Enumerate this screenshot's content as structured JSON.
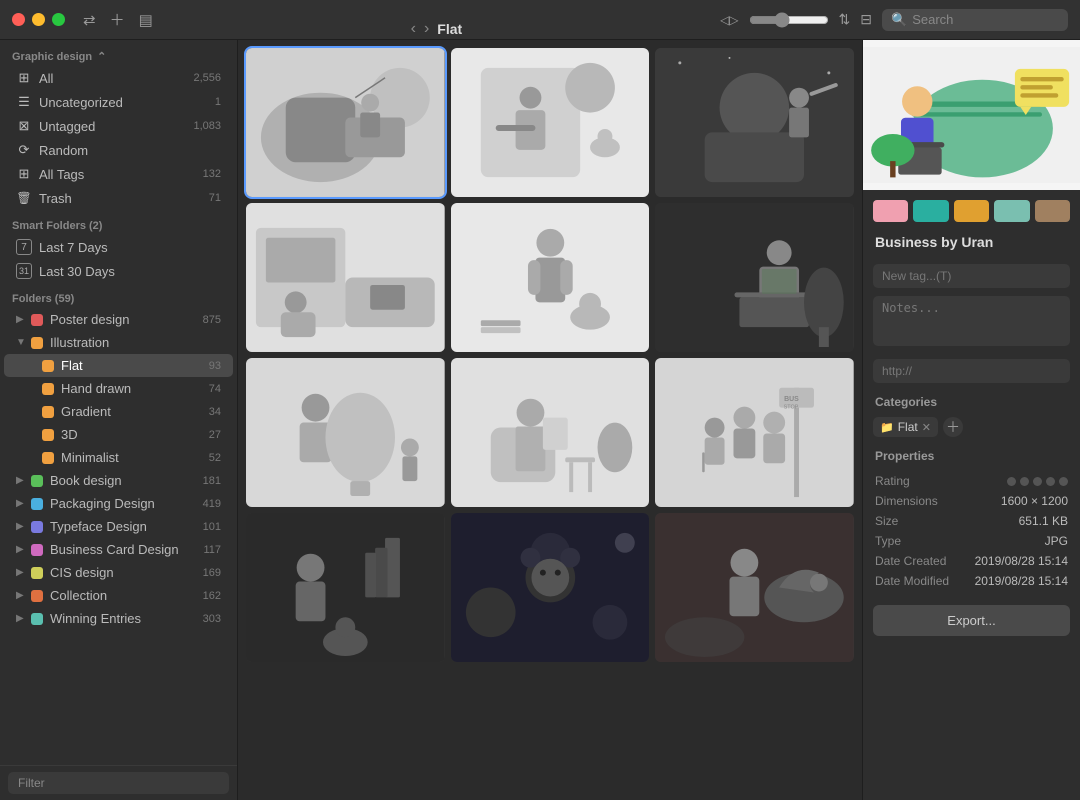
{
  "titlebar": {
    "folder_name": "Flat",
    "search_placeholder": "Search",
    "traffic_lights": [
      "close",
      "minimize",
      "maximize"
    ]
  },
  "sidebar": {
    "section_graphic": "Graphic design",
    "items_main": [
      {
        "label": "All",
        "count": "2,556",
        "icon": "⊞"
      },
      {
        "label": "Uncategorized",
        "count": "1",
        "icon": "☰"
      },
      {
        "label": "Untagged",
        "count": "1,083",
        "icon": "⊠"
      },
      {
        "label": "Random",
        "count": "",
        "icon": "⟳"
      },
      {
        "label": "All Tags",
        "count": "132",
        "icon": "⊞"
      },
      {
        "label": "Trash",
        "count": "71",
        "icon": "🗑"
      }
    ],
    "smart_folders_header": "Smart Folders (2)",
    "smart_folders": [
      {
        "label": "Last 7 Days",
        "icon": "7"
      },
      {
        "label": "Last 30 Days",
        "icon": "31"
      }
    ],
    "folders_header": "Folders (59)",
    "folders": [
      {
        "label": "Poster design",
        "count": "875",
        "color": "#e05a5a",
        "expanded": false,
        "indent": 0
      },
      {
        "label": "Illustration",
        "count": "",
        "color": "#f0a040",
        "expanded": true,
        "indent": 0
      },
      {
        "label": "Flat",
        "count": "93",
        "color": "#f0a040",
        "expanded": false,
        "indent": 1,
        "active": true
      },
      {
        "label": "Hand drawn",
        "count": "74",
        "color": "#f0a040",
        "expanded": false,
        "indent": 1
      },
      {
        "label": "Gradient",
        "count": "34",
        "color": "#f0a040",
        "expanded": false,
        "indent": 1
      },
      {
        "label": "3D",
        "count": "27",
        "color": "#f0a040",
        "expanded": false,
        "indent": 1
      },
      {
        "label": "Minimalist",
        "count": "52",
        "color": "#f0a040",
        "expanded": false,
        "indent": 1
      },
      {
        "label": "Book design",
        "count": "181",
        "color": "#5abf5a",
        "expanded": false,
        "indent": 0
      },
      {
        "label": "Packaging Design",
        "count": "419",
        "color": "#4aafdf",
        "expanded": false,
        "indent": 0
      },
      {
        "label": "Typeface Design",
        "count": "101",
        "color": "#7a7adf",
        "expanded": false,
        "indent": 0
      },
      {
        "label": "Business Card Design",
        "count": "117",
        "color": "#cf6abf",
        "expanded": false,
        "indent": 0
      },
      {
        "label": "CIS design",
        "count": "169",
        "color": "#cfcf5a",
        "expanded": false,
        "indent": 0
      },
      {
        "label": "Collection",
        "count": "162",
        "color": "#e07040",
        "expanded": false,
        "indent": 0
      },
      {
        "label": "Winning Entries",
        "count": "303",
        "color": "#5abfaf",
        "expanded": false,
        "indent": 0
      }
    ],
    "filter_placeholder": "Filter"
  },
  "right_panel": {
    "title": "Business by Uran",
    "tag_placeholder": "New tag...(T)",
    "notes_placeholder": "Notes...",
    "url_placeholder": "http://",
    "categories_label": "Categories",
    "category_tag": "Flat",
    "properties_label": "Properties",
    "properties": [
      {
        "label": "Rating",
        "value": "dots"
      },
      {
        "label": "Dimensions",
        "value": "1600 × 1200"
      },
      {
        "label": "Size",
        "value": "651.1 KB"
      },
      {
        "label": "Type",
        "value": "JPG"
      },
      {
        "label": "Date Created",
        "value": "2019/08/28  15:14"
      },
      {
        "label": "Date Modified",
        "value": "2019/08/28  15:14"
      }
    ],
    "export_label": "Export...",
    "palette_colors": [
      "#f0a0b0",
      "#2aafa0",
      "#e0a030",
      "#7abfb0",
      "#a08060"
    ]
  },
  "grid": {
    "items_count": 12
  }
}
